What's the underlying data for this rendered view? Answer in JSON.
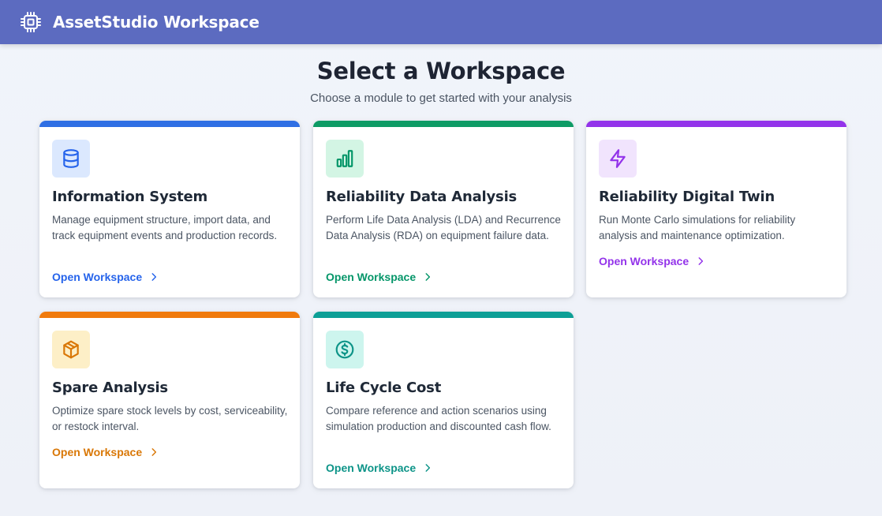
{
  "header": {
    "title": "AssetStudio Workspace",
    "logo_icon": "cpu-chip-icon",
    "background": "#5c6bc0"
  },
  "main": {
    "heading": "Select a Workspace",
    "subheading": "Choose a module to get started with your analysis"
  },
  "cards": [
    {
      "title": "Information System",
      "description": "Manage equipment structure, import data, and track equipment events and production records.",
      "link": "Open Workspace",
      "icon": "database-icon",
      "accent": "#2f6fe4",
      "icon_bg": "#dbe8fe",
      "icon_color": "#2563eb",
      "link_color": "#2563eb"
    },
    {
      "title": "Reliability Data Analysis",
      "description": "Perform Life Data Analysis (LDA) and Recurrence Data Analysis (RDA) on equipment failure data.",
      "link": "Open Workspace",
      "icon": "bar-chart-icon",
      "accent": "#0e9b65",
      "icon_bg": "#d3f5e4",
      "icon_color": "#059669",
      "link_color": "#059669"
    },
    {
      "title": "Reliability Digital Twin",
      "description": "Run Monte Carlo simulations for reliability analysis and maintenance optimization.",
      "link": "Open Workspace",
      "icon": "lightning-bolt-icon",
      "accent": "#9333ea",
      "icon_bg": "#f1e4fd",
      "icon_color": "#9333ea",
      "link_color": "#9333ea"
    },
    {
      "title": "Spare Analysis",
      "description": "Optimize spare stock levels by cost, serviceability, or restock interval.",
      "link": "Open Workspace",
      "icon": "cube-icon",
      "accent": "#f07a0c",
      "icon_bg": "#fdefc7",
      "icon_color": "#d97706",
      "link_color": "#d97706"
    },
    {
      "title": "Life Cycle Cost",
      "description": "Compare reference and action scenarios using simulation production and discounted cash flow.",
      "link": "Open Workspace",
      "icon": "dollar-circle-icon",
      "accent": "#0d9f96",
      "icon_bg": "#cdf5ee",
      "icon_color": "#0d9488",
      "link_color": "#0d9488"
    }
  ]
}
